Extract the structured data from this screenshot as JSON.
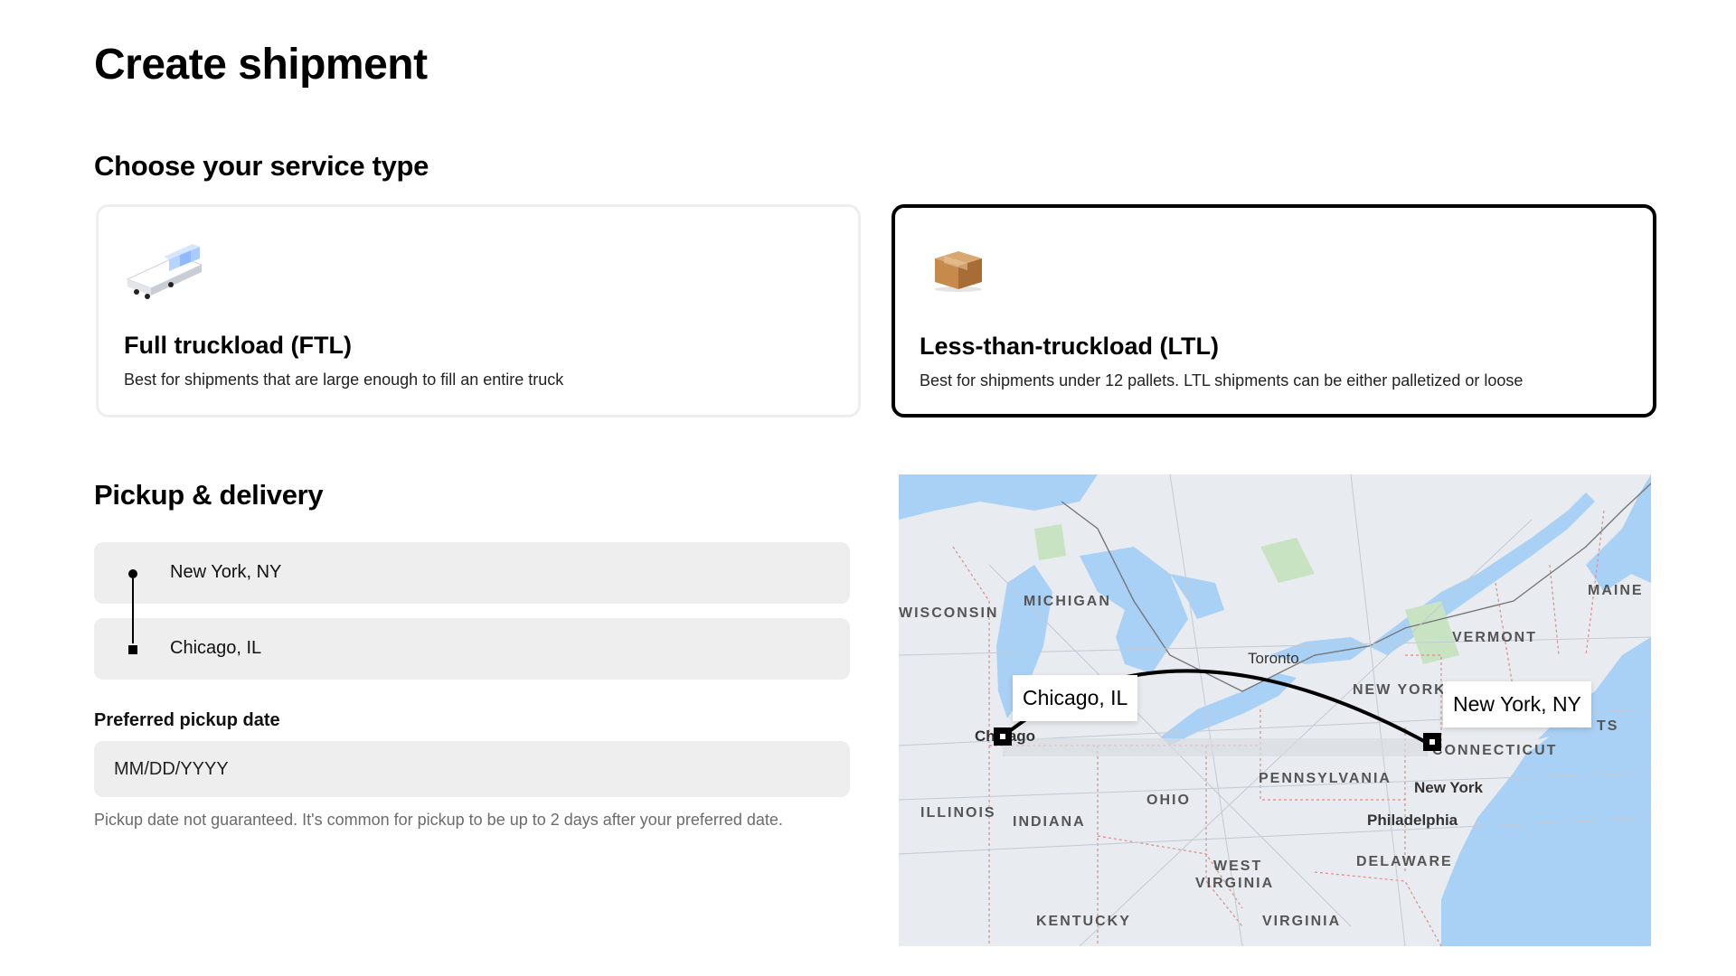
{
  "page": {
    "title": "Create shipment"
  },
  "service": {
    "heading": "Choose your service type",
    "options": [
      {
        "icon": "truck-icon",
        "title": "Full truckload (FTL)",
        "description": "Best for shipments that are large enough to fill an entire truck",
        "selected": false
      },
      {
        "icon": "package-box-icon",
        "title": "Less-than-truckload (LTL)",
        "description": "Best for shipments under 12 pallets. LTL shipments can be either palletized or loose",
        "selected": true
      }
    ]
  },
  "pickup_delivery": {
    "heading": "Pickup & delivery",
    "origin": "New York, NY",
    "destination": "Chicago, IL",
    "date_label": "Preferred pickup date",
    "date_placeholder": "MM/DD/YYYY",
    "date_help": "Pickup date not guaranteed. It's common for pickup to be up to 2 days after your preferred date."
  },
  "map": {
    "origin_label": "Chicago, IL",
    "destination_label": "New York, NY",
    "region_labels": [
      "WISCONSIN",
      "MICHIGAN",
      "VERMONT",
      "MAINE",
      "NEW YORK",
      "CONNECTICUT",
      "PENNSYLVANIA",
      "OHIO",
      "ILLINOIS",
      "INDIANA",
      "WEST",
      "VIRGINIA",
      "KENTUCKY",
      "VIRGINIA",
      "DELAWARE",
      "TS"
    ],
    "city_labels": [
      "Toronto",
      "Chicago",
      "New York",
      "Philadelphia"
    ],
    "colors": {
      "water": "#a9d0f5",
      "land": "#e8ebef",
      "park": "#c7e3c2",
      "route": "#000000"
    }
  }
}
